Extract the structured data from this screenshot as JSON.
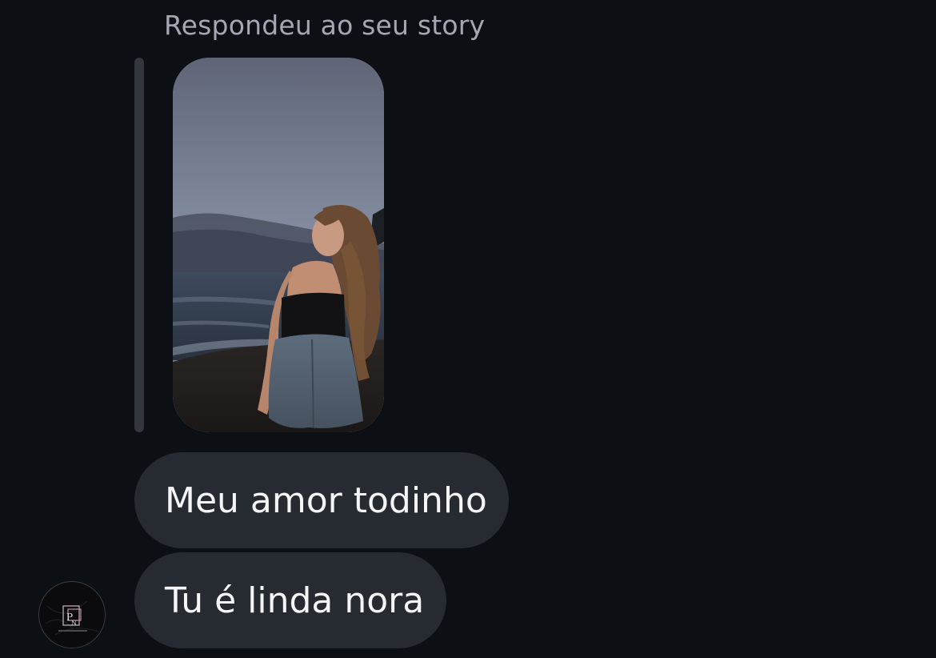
{
  "thread": {
    "reply_caption": "Respondeu ao seu story",
    "story": {
      "description_icon": "story-photo"
    },
    "messages": [
      {
        "text": "Meu amor todinho"
      },
      {
        "text": "Tu é linda nora"
      }
    ],
    "avatar": {
      "logo_text": "Patricia campos nails"
    }
  },
  "colors": {
    "background": "#0c0f14",
    "bubble": "#262a31",
    "caption": "#a4a8b2",
    "quote_bar": "#32363e",
    "message_text": "#f4f5f7"
  }
}
